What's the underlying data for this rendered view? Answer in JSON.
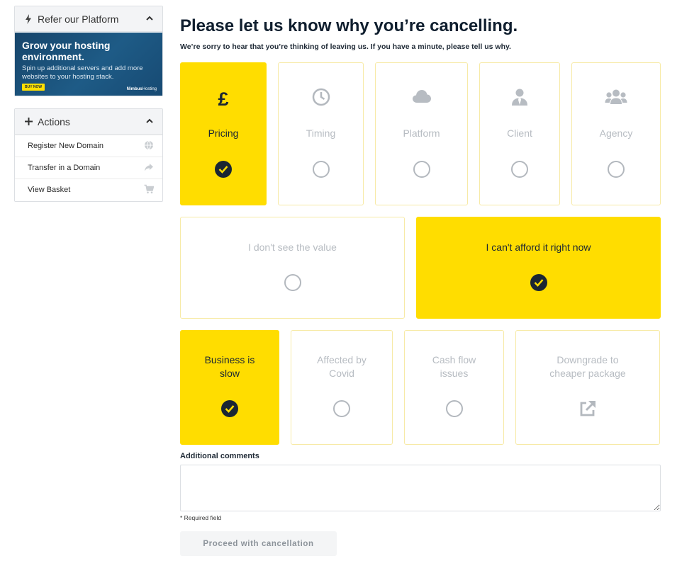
{
  "sidebar": {
    "refer": {
      "title": "Refer our Platform",
      "banner": {
        "heading": "Grow your hosting environment.",
        "text": "Spin up additional servers and add more websites to your hosting stack.",
        "button": "BUY NOW",
        "logo_brand": "Nimbus",
        "logo_suffix": "Hosting"
      }
    },
    "actions": {
      "title": "Actions",
      "items": [
        {
          "label": "Register New Domain",
          "icon": "globe-icon"
        },
        {
          "label": "Transfer in a Domain",
          "icon": "share-arrow-icon"
        },
        {
          "label": "View Basket",
          "icon": "cart-icon"
        }
      ]
    }
  },
  "main": {
    "title": "Please let us know why you’re cancelling.",
    "subtitle": "We’re sorry to hear that you’re thinking of leaving us. If you have a minute, please tell us why.",
    "categories": [
      {
        "label": "Pricing",
        "icon": "pound-icon",
        "selected": true
      },
      {
        "label": "Timing",
        "icon": "clock-icon",
        "selected": false
      },
      {
        "label": "Platform",
        "icon": "cloud-icon",
        "selected": false
      },
      {
        "label": "Client",
        "icon": "user-tie-icon",
        "selected": false
      },
      {
        "label": "Agency",
        "icon": "users-icon",
        "selected": false
      }
    ],
    "pricing_reasons": [
      {
        "label": "I don't see the value",
        "selected": false
      },
      {
        "label": "I can't afford it right now",
        "selected": true
      }
    ],
    "afford_reasons": [
      {
        "label": "Business is slow",
        "selected": true
      },
      {
        "label": "Affected by Covid",
        "selected": false
      },
      {
        "label": "Cash flow issues",
        "selected": false
      },
      {
        "label": "Downgrade to cheaper package",
        "icon": "external-link-icon",
        "selected": false
      }
    ],
    "comments_label": "Additional comments",
    "comments_value": "",
    "required_note": "* Required field",
    "proceed_label": "Proceed with cancellation"
  },
  "colors": {
    "accent": "#ffdd00",
    "dark": "#1b2633",
    "muted": "#b7bcc2",
    "banner": "#1e5b86"
  }
}
